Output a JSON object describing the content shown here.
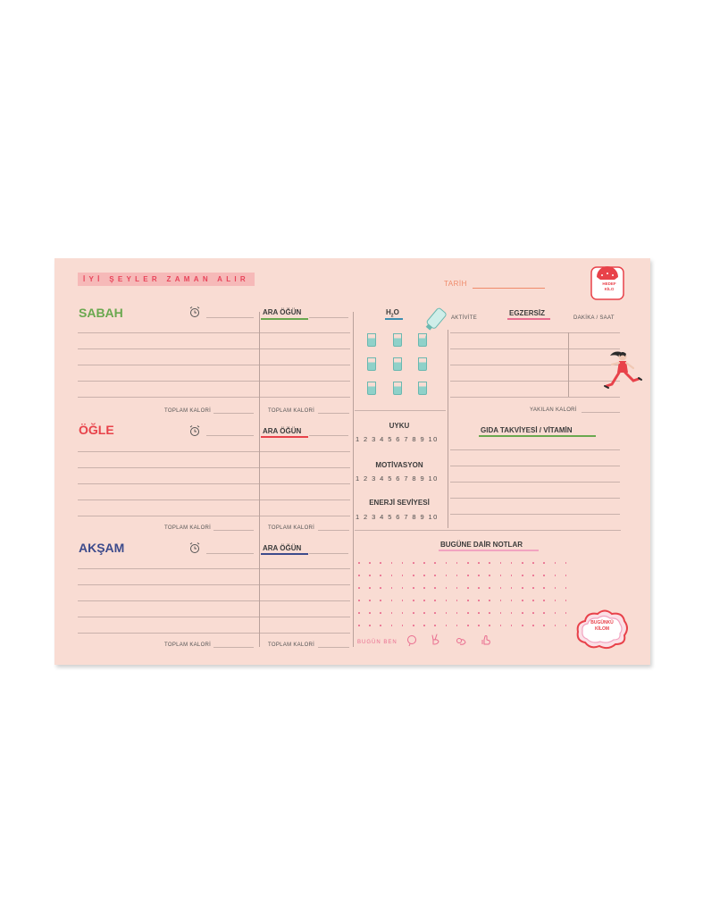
{
  "tagline": "İYİ ŞEYLER ZAMAN ALIR",
  "tarih_label": "TARİH",
  "meals": [
    {
      "name": "SABAH",
      "color": "#6aa84f"
    },
    {
      "name": "ÖĞLE",
      "color": "#e8424a"
    },
    {
      "name": "AKŞAM",
      "color": "#3d4b8c"
    }
  ],
  "ara_ogun_label": "ARA ÖĞÜN",
  "toplam_kalori_label": "TOPLAM KALORİ",
  "h2o_label": "H2O",
  "aktivite_label": "AKTİVİTE",
  "egzersiz_label": "EGZERSİZ",
  "dakika_saat_label": "DAKİKA / SAAT",
  "yakilan_kalori_label": "YAKILAN KALORİ",
  "gida_label": "GIDA TAKVİYESİ / VİTAMİN",
  "scales": [
    {
      "label": "UYKU",
      "numbers": "1 2 3 4 5 6 7 8 9 10"
    },
    {
      "label": "MOTİVASYON",
      "numbers": "1 2 3 4 5 6 7 8 9 10"
    },
    {
      "label": "ENERJİ SEVİYESİ",
      "numbers": "1 2 3 4 5 6 7 8 9 10"
    }
  ],
  "notlar_label": "BUGÜNE DAİR NOTLAR",
  "bugun_ben_label": "BUGÜN BEN",
  "hedef_kilo_lines": [
    "HEDEF",
    "KİLO"
  ],
  "bugunku_kilom_lines": [
    "BUGÜNKÜ",
    "KİLOM"
  ],
  "colors": {
    "sheet": "#f9dcd3",
    "accent_pink": "#e8445a",
    "underline_green": "#6aa84f",
    "underline_red": "#e8424a",
    "underline_blue": "#3d4b8c",
    "underline_pink": "#f2a3c0",
    "water": "#8fd1c9"
  },
  "icons": [
    "alarm-clock-icon",
    "water-bottle-icon",
    "water-glass-icon",
    "runner-woman-icon",
    "scale-icon",
    "cloud-badge-icon",
    "mood-face-icon",
    "peace-hand-icon",
    "ok-hand-icon",
    "thumbs-up-icon"
  ]
}
